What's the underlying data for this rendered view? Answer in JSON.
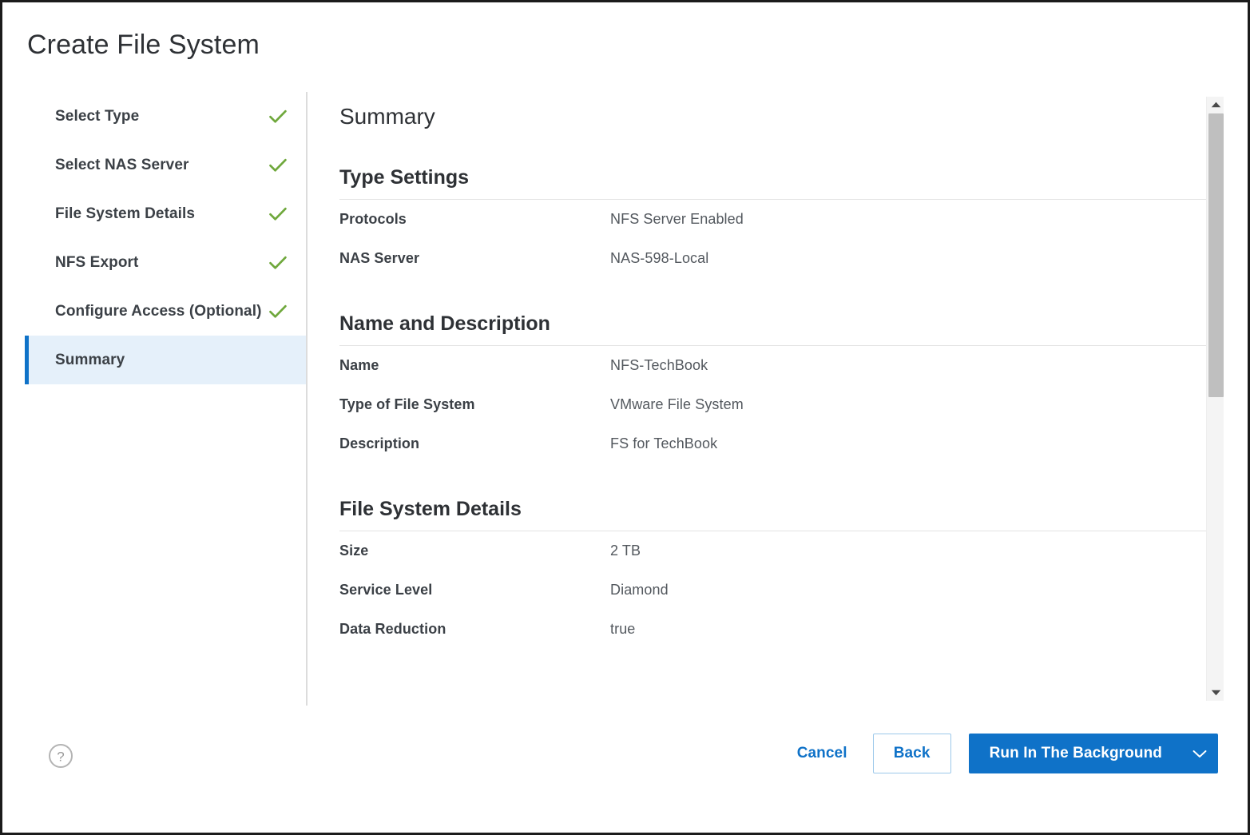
{
  "dialog": {
    "title": "Create File System"
  },
  "colors": {
    "accent_blue": "#0f72c8",
    "check_green": "#6fa83c",
    "selected_step_bg": "#e5f0fa",
    "label_text": "#3b4046",
    "value_text": "#53585e",
    "scrollbar_thumb": "#bfbfbf"
  },
  "sidebar": {
    "items": [
      {
        "label": "Select Type",
        "completed": true,
        "current": false,
        "icon": "check-icon"
      },
      {
        "label": "Select NAS Server",
        "completed": true,
        "current": false,
        "icon": "check-icon"
      },
      {
        "label": "File System Details",
        "completed": true,
        "current": false,
        "icon": "check-icon"
      },
      {
        "label": "NFS Export",
        "completed": true,
        "current": false,
        "icon": "check-icon"
      },
      {
        "label": "Configure Access (Optional)",
        "completed": true,
        "current": false,
        "icon": "check-icon"
      },
      {
        "label": "Summary",
        "completed": false,
        "current": true,
        "icon": null
      }
    ]
  },
  "main": {
    "heading": "Summary",
    "sections": [
      {
        "title": "Type Settings",
        "rows": [
          {
            "key": "Protocols",
            "value": "NFS Server Enabled"
          },
          {
            "key": "NAS Server",
            "value": "NAS-598-Local"
          }
        ]
      },
      {
        "title": "Name and Description",
        "rows": [
          {
            "key": "Name",
            "value": "NFS-TechBook"
          },
          {
            "key": "Type of File System",
            "value": "VMware File System"
          },
          {
            "key": "Description",
            "value": "FS for TechBook"
          }
        ]
      },
      {
        "title": "File System Details",
        "rows": [
          {
            "key": "Size",
            "value": "2 TB"
          },
          {
            "key": "Service Level",
            "value": "Diamond"
          },
          {
            "key": "Data Reduction",
            "value": "true"
          }
        ]
      }
    ]
  },
  "scrollbar": {
    "up_icon": "triangle-up-icon",
    "down_icon": "triangle-down-icon"
  },
  "footer": {
    "help_icon": "help-circle-icon",
    "cancel_label": "Cancel",
    "back_label": "Back",
    "run_background_label": "Run In The Background",
    "run_background_caret_icon": "chevron-down-icon"
  }
}
